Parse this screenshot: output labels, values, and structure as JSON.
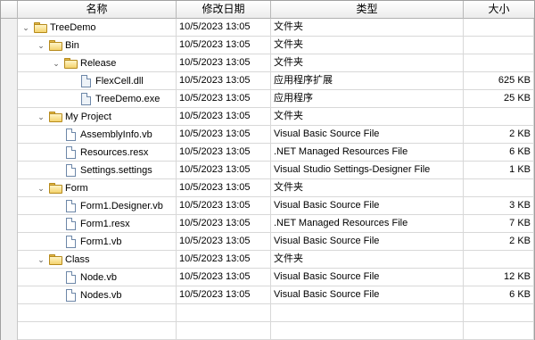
{
  "headers": {
    "name": "名称",
    "date": "修改日期",
    "type": "类型",
    "size": "大小"
  },
  "rows": [
    {
      "level": 0,
      "kind": "folder",
      "expanded": true,
      "name": "TreeDemo",
      "date": "10/5/2023 13:05",
      "type": "文件夹",
      "size": ""
    },
    {
      "level": 1,
      "kind": "folder",
      "expanded": true,
      "name": "Bin",
      "date": "10/5/2023 13:05",
      "type": "文件夹",
      "size": ""
    },
    {
      "level": 2,
      "kind": "folder",
      "expanded": true,
      "name": "Release",
      "date": "10/5/2023 13:05",
      "type": "文件夹",
      "size": ""
    },
    {
      "level": 3,
      "kind": "file-bin",
      "name": "FlexCell.dll",
      "date": "10/5/2023 13:05",
      "type": "应用程序扩展",
      "size": "625 KB"
    },
    {
      "level": 3,
      "kind": "file-bin",
      "name": "TreeDemo.exe",
      "date": "10/5/2023 13:05",
      "type": "应用程序",
      "size": "25 KB"
    },
    {
      "level": 1,
      "kind": "folder",
      "expanded": true,
      "name": "My Project",
      "date": "10/5/2023 13:05",
      "type": "文件夹",
      "size": ""
    },
    {
      "level": 2,
      "kind": "file",
      "name": "AssemblyInfo.vb",
      "date": "10/5/2023 13:05",
      "type": "Visual Basic Source File",
      "size": "2 KB"
    },
    {
      "level": 2,
      "kind": "file",
      "name": "Resources.resx",
      "date": "10/5/2023 13:05",
      "type": ".NET Managed Resources File",
      "size": "6 KB"
    },
    {
      "level": 2,
      "kind": "file",
      "name": "Settings.settings",
      "date": "10/5/2023 13:05",
      "type": "Visual Studio Settings-Designer File",
      "size": "1 KB"
    },
    {
      "level": 1,
      "kind": "folder",
      "expanded": true,
      "name": "Form",
      "date": "10/5/2023 13:05",
      "type": "文件夹",
      "size": ""
    },
    {
      "level": 2,
      "kind": "file",
      "name": "Form1.Designer.vb",
      "date": "10/5/2023 13:05",
      "type": "Visual Basic Source File",
      "size": "3 KB"
    },
    {
      "level": 2,
      "kind": "file",
      "name": "Form1.resx",
      "date": "10/5/2023 13:05",
      "type": ".NET Managed Resources File",
      "size": "7 KB"
    },
    {
      "level": 2,
      "kind": "file",
      "name": "Form1.vb",
      "date": "10/5/2023 13:05",
      "type": "Visual Basic Source File",
      "size": "2 KB"
    },
    {
      "level": 1,
      "kind": "folder",
      "expanded": true,
      "name": "Class",
      "date": "10/5/2023 13:05",
      "type": "文件夹",
      "size": ""
    },
    {
      "level": 2,
      "kind": "file",
      "name": "Node.vb",
      "date": "10/5/2023 13:05",
      "type": "Visual Basic Source File",
      "size": "12 KB"
    },
    {
      "level": 2,
      "kind": "file",
      "name": "Nodes.vb",
      "date": "10/5/2023 13:05",
      "type": "Visual Basic Source File",
      "size": "6 KB"
    },
    {
      "level": 0,
      "kind": "empty",
      "name": "",
      "date": "",
      "type": "",
      "size": ""
    },
    {
      "level": 0,
      "kind": "empty",
      "name": "",
      "date": "",
      "type": "",
      "size": ""
    }
  ]
}
